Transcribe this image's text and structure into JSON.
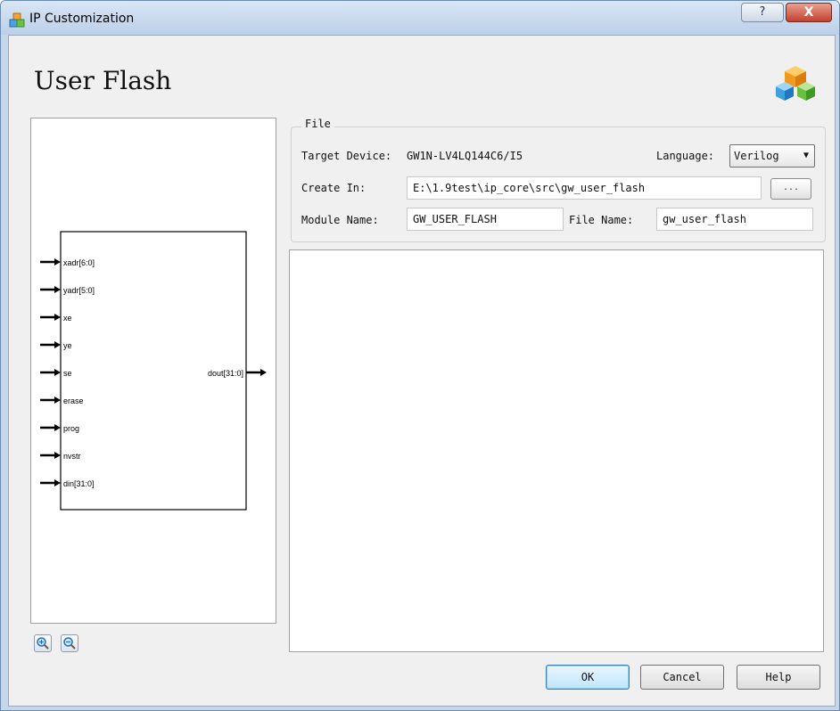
{
  "window": {
    "title": "IP Customization",
    "help_button": "?",
    "close_button": "X",
    "app_icon": "ip-cubes-icon"
  },
  "header": {
    "title": "User Flash",
    "logo_icon": "ip-cubes-logo-icon"
  },
  "diagram": {
    "inputs": [
      "xadr[6:0]",
      "yadr[5:0]",
      "xe",
      "ye",
      "se",
      "erase",
      "prog",
      "nvstr",
      "din[31:0]"
    ],
    "outputs": [
      "dout[31:0]"
    ]
  },
  "zoom": {
    "zoom_in_icon": "zoom-in-icon",
    "zoom_out_icon": "zoom-out-icon"
  },
  "file": {
    "group_label": "File",
    "target_device_label": "Target Device:",
    "target_device_value": "GW1N-LV4LQ144C6/I5",
    "language_label": "Language:",
    "language_value": "Verilog",
    "create_in_label": "Create In:",
    "create_in_value": "E:\\1.9test\\ip_core\\src\\gw_user_flash",
    "browse_label": "...",
    "module_name_label": "Module Name:",
    "module_name_value": "GW_USER_FLASH",
    "file_name_label": "File Name:",
    "file_name_value": "gw_user_flash"
  },
  "buttons": {
    "ok": "OK",
    "cancel": "Cancel",
    "help": "Help"
  }
}
